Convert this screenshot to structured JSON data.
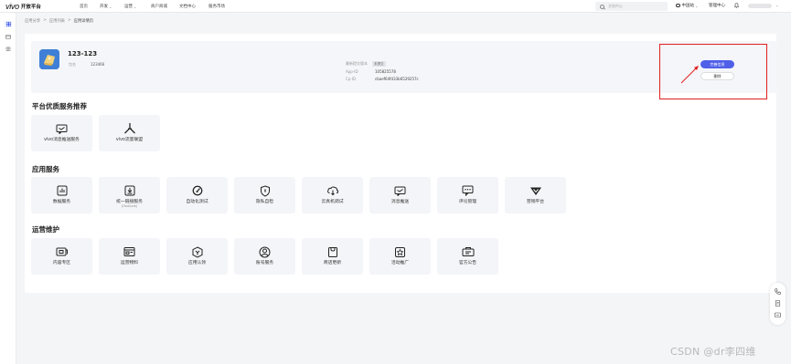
{
  "topbar": {
    "logo_text": "vivo",
    "platform_name": "开放平台",
    "nav": [
      {
        "label": "首页",
        "has_menu": false
      },
      {
        "label": "开发",
        "has_menu": true
      },
      {
        "label": "运营",
        "has_menu": true
      },
      {
        "label": "商户商城",
        "has_menu": false
      },
      {
        "label": "文档中心",
        "has_menu": false
      },
      {
        "label": "服务市场",
        "has_menu": false
      }
    ],
    "search_placeholder": "文档中心",
    "region_label": "中国站",
    "management_label": "管理中心"
  },
  "breadcrumb": [
    "应用分享",
    "应用列表",
    "应用详情页"
  ],
  "app": {
    "name": "123-123",
    "package_label": "包名",
    "package_value": "123466",
    "meta": [
      {
        "key": "最新提交版本",
        "value": "",
        "tag": "未提交"
      },
      {
        "key": "App-ID",
        "value": "105825578",
        "tag": ""
      },
      {
        "key": "Cp-ID",
        "value": "cbaef64fd33b6529257c",
        "tag": ""
      }
    ],
    "primary_action": "完善信息",
    "secondary_action": "删除"
  },
  "sections": [
    {
      "title": "平台优质服务推荐",
      "items": [
        {
          "label": "vivo消息推送服务",
          "sub": "",
          "icon": "message-push-icon"
        },
        {
          "label": "vivo流量联盟",
          "sub": "",
          "icon": "traffic-alliance-icon"
        }
      ]
    },
    {
      "title": "应用服务",
      "items": [
        {
          "label": "数据服务",
          "sub": "",
          "icon": "data-chart-icon"
        },
        {
          "label": "统一链接服务",
          "sub": "(OneLink)",
          "icon": "download-link-icon"
        },
        {
          "label": "自动化测试",
          "sub": "",
          "icon": "gauge-icon"
        },
        {
          "label": "隐私自检",
          "sub": "",
          "icon": "shield-check-icon"
        },
        {
          "label": "云真机调试",
          "sub": "",
          "icon": "cloud-device-icon"
        },
        {
          "label": "消息推送",
          "sub": "",
          "icon": "message-push-icon"
        },
        {
          "label": "评论管理",
          "sub": "",
          "icon": "comment-icon"
        },
        {
          "label": "营销平台",
          "sub": "",
          "icon": "marketing-icon"
        }
      ]
    },
    {
      "title": "运营维护",
      "items": [
        {
          "label": "内容专区",
          "sub": "",
          "icon": "content-zone-icon"
        },
        {
          "label": "运营物料",
          "sub": "",
          "icon": "materials-icon"
        },
        {
          "label": "应用认领",
          "sub": "",
          "icon": "claim-icon"
        },
        {
          "label": "账号服务",
          "sub": "",
          "icon": "account-icon"
        },
        {
          "label": "商店更新",
          "sub": "",
          "icon": "store-update-icon"
        },
        {
          "label": "活动推广",
          "sub": "",
          "icon": "promotion-icon"
        },
        {
          "label": "官方公告",
          "sub": "",
          "icon": "announcement-icon"
        }
      ]
    }
  ],
  "watermark": "CSDN @dr李四维",
  "colors": {
    "primary": "#4f5fe8",
    "highlight": "#e02020",
    "app_icon": "#3f7fd6"
  }
}
